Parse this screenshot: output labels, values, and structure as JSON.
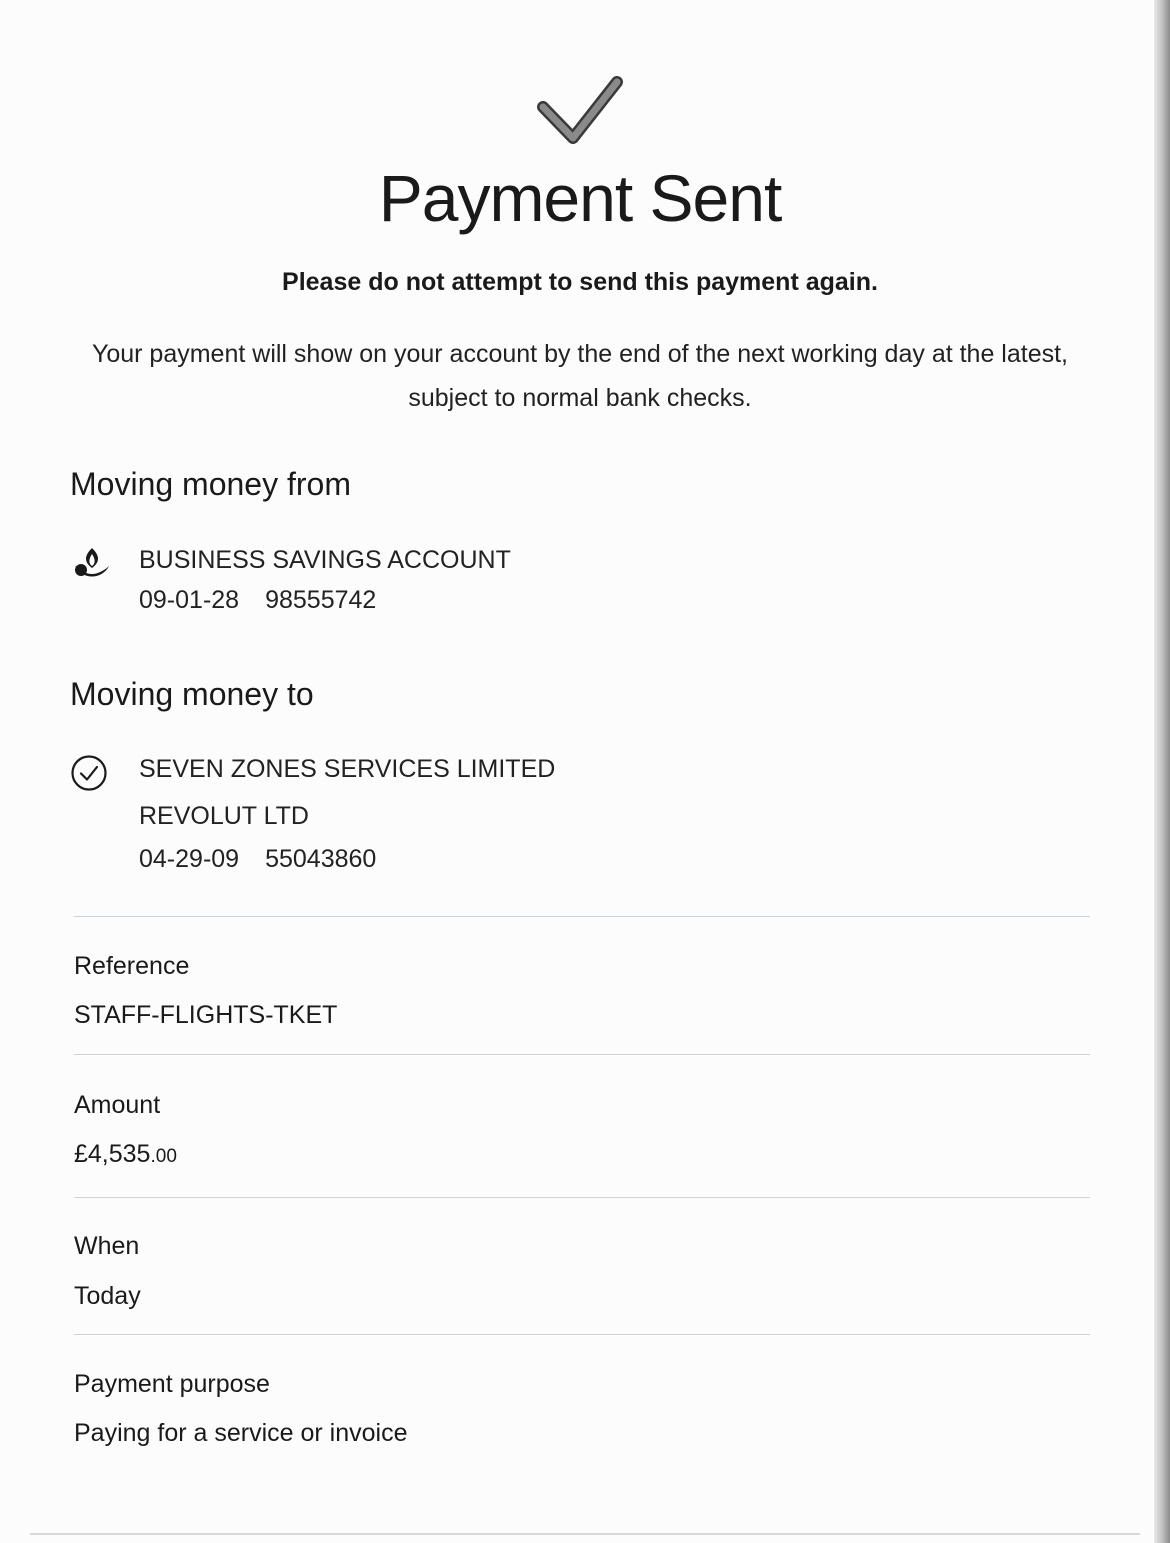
{
  "header": {
    "title": "Payment Sent",
    "warning": "Please do not attempt to send this payment again.",
    "info": "Your payment will show on your account by the end of the next working day at the latest, subject to normal bank checks."
  },
  "from": {
    "section_title": "Moving money from",
    "icon": "bank-logo-icon",
    "account_name": "BUSINESS SAVINGS ACCOUNT",
    "sort_code": "09-01-28",
    "account_number": "98555742"
  },
  "to": {
    "section_title": "Moving money to",
    "icon": "check-circle-icon",
    "payee_name": "SEVEN ZONES SERVICES LIMITED",
    "bank": "REVOLUT LTD",
    "sort_code": "04-29-09",
    "account_number": "55043860"
  },
  "details": {
    "reference_label": "Reference",
    "reference_value": "STAFF-FLIGHTS-TKET",
    "amount_label": "Amount",
    "amount_main": "£4,535",
    "amount_pence": ".00",
    "when_label": "When",
    "when_value": "Today",
    "purpose_label": "Payment purpose",
    "purpose_value": "Paying for a service or invoice"
  },
  "colors": {
    "text": "#1a1a1a",
    "divider": "#cfd3d6",
    "check": "#6f6f6f"
  }
}
